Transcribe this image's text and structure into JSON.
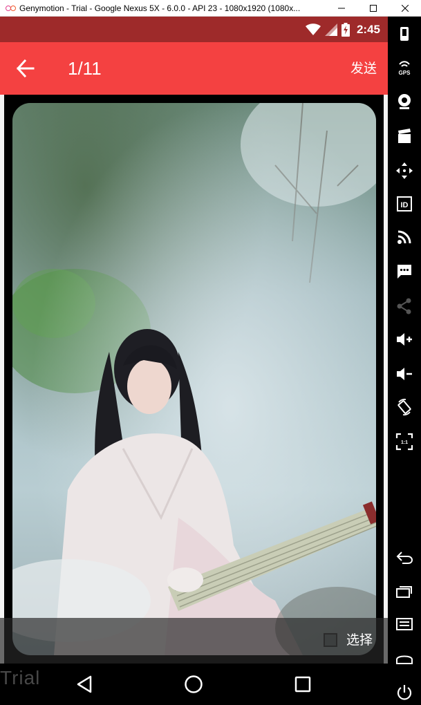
{
  "window": {
    "title": "Genymotion - Trial - Google Nexus 5X - 6.0.0 - API 23 - 1080x1920 (1080x..."
  },
  "status_bar": {
    "time": "2:45",
    "icons": [
      "wifi-icon",
      "signal-icon",
      "battery-charging-icon"
    ]
  },
  "toolbar": {
    "counter": "1/11",
    "send_label": "发送",
    "back_icon": "arrow-back-icon",
    "background": "#f44141"
  },
  "photo": {
    "description_icon": "photo-preview"
  },
  "bottom_bar": {
    "select_label": "选择",
    "checked": false
  },
  "nav_bar": {
    "buttons": [
      "back-triangle-icon",
      "home-circle-icon",
      "recents-square-icon"
    ]
  },
  "watermark": "Trial",
  "side_panel": {
    "gps_label": "GPS",
    "id_label": "ID",
    "ratio_label": "1:1",
    "buttons": [
      "power-icon",
      "gps-icon",
      "camera-icon",
      "clapper-icon",
      "move-icon",
      "id-icon",
      "rss-icon",
      "sms-icon",
      "share-icon",
      "volume-up-icon",
      "volume-down-icon",
      "rotate-icon",
      "pixel-ratio-icon",
      "back-icon",
      "recents-icon",
      "menu-icon",
      "home-icon",
      "power-icon"
    ]
  }
}
